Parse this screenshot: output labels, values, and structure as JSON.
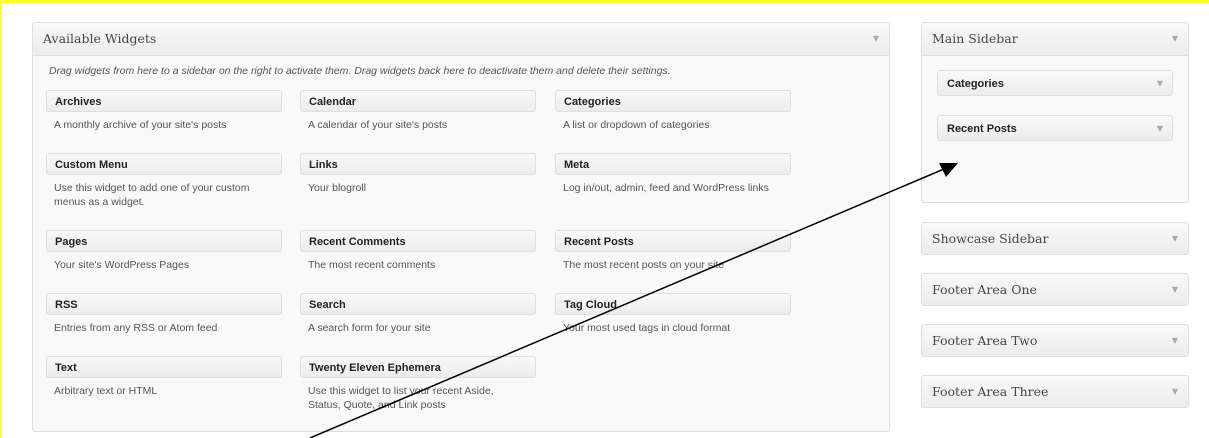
{
  "available": {
    "title": "Available Widgets",
    "description": "Drag widgets from here to a sidebar on the right to activate them. Drag widgets back here to deactivate them and delete their settings.",
    "widgets": [
      {
        "title": "Archives",
        "desc": "A monthly archive of your site's posts"
      },
      {
        "title": "Calendar",
        "desc": "A calendar of your site's posts"
      },
      {
        "title": "Categories",
        "desc": "A list or dropdown of categories"
      },
      {
        "title": "Custom Menu",
        "desc": "Use this widget to add one of your custom menus as a widget."
      },
      {
        "title": "Links",
        "desc": "Your blogroll"
      },
      {
        "title": "Meta",
        "desc": "Log in/out, admin, feed and WordPress links"
      },
      {
        "title": "Pages",
        "desc": "Your site's WordPress Pages"
      },
      {
        "title": "Recent Comments",
        "desc": "The most recent comments"
      },
      {
        "title": "Recent Posts",
        "desc": "The most recent posts on your site"
      },
      {
        "title": "RSS",
        "desc": "Entries from any RSS or Atom feed"
      },
      {
        "title": "Search",
        "desc": "A search form for your site"
      },
      {
        "title": "Tag Cloud",
        "desc": "Your most used tags in cloud format"
      },
      {
        "title": "Text",
        "desc": "Arbitrary text or HTML"
      },
      {
        "title": "Twenty Eleven Ephemera",
        "desc": "Use this widget to list your recent Aside, Status, Quote, and Link posts"
      }
    ]
  },
  "sidebars": {
    "main": {
      "title": "Main Sidebar",
      "widgets": [
        "Categories",
        "Recent Posts"
      ]
    },
    "showcase": {
      "title": "Showcase Sidebar"
    },
    "footer_one": {
      "title": "Footer Area One"
    },
    "footer_two": {
      "title": "Footer Area Two"
    },
    "footer_three": {
      "title": "Footer Area Three"
    }
  },
  "arrow_glyph": "▼",
  "colors": {
    "highlight_border": "#ffff33",
    "panel_bg": "#f9f9f9",
    "border": "#dfdfdf"
  }
}
